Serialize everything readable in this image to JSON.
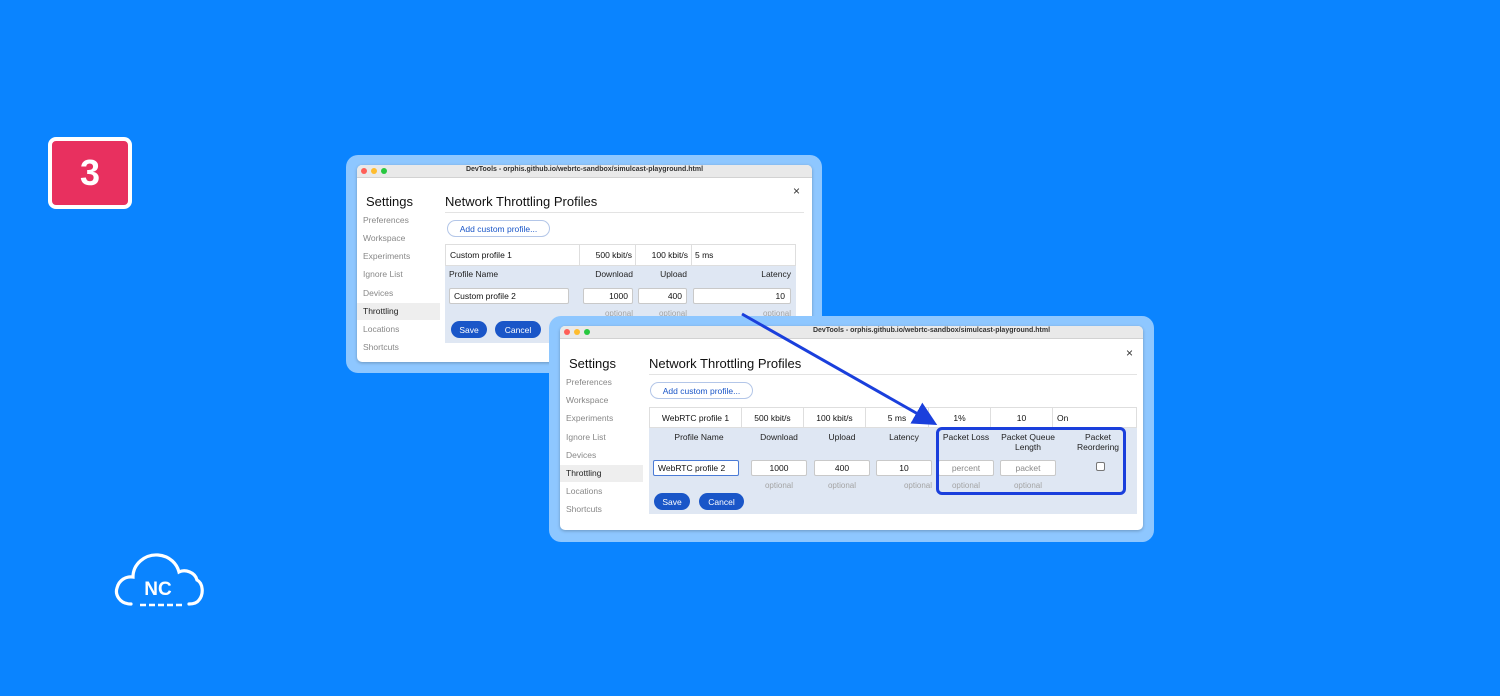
{
  "step": {
    "number": "3"
  },
  "logo": {
    "text": "NC"
  },
  "colors": {
    "background": "#0a84ff",
    "badge": "#e8305f",
    "accent": "#1a56c8",
    "highlight": "#1a3fdc",
    "panel": "#dfe7f3"
  },
  "window1": {
    "title": "DevTools - orphis.github.io/webrtc-sandbox/simulcast-playground.html",
    "close": "×",
    "sidebar": {
      "title": "Settings",
      "items": [
        {
          "label": "Preferences"
        },
        {
          "label": "Workspace"
        },
        {
          "label": "Experiments"
        },
        {
          "label": "Ignore List"
        },
        {
          "label": "Devices"
        },
        {
          "label": "Throttling"
        },
        {
          "label": "Locations"
        },
        {
          "label": "Shortcuts"
        }
      ]
    },
    "heading": "Network Throttling Profiles",
    "add_button": "Add custom profile...",
    "existing_profile": {
      "name": "Custom profile 1",
      "download": "500 kbit/s",
      "upload": "100 kbit/s",
      "latency": "5 ms"
    },
    "columns": {
      "name": "Profile Name",
      "download": "Download",
      "upload": "Upload",
      "latency": "Latency"
    },
    "form": {
      "name": "Custom profile 2",
      "download": "1000",
      "upload": "400",
      "latency": "10"
    },
    "optional": "optional",
    "save": "Save",
    "cancel": "Cancel"
  },
  "window2": {
    "title": "DevTools - orphis.github.io/webrtc-sandbox/simulcast-playground.html",
    "close": "×",
    "sidebar": {
      "title": "Settings",
      "items": [
        {
          "label": "Preferences"
        },
        {
          "label": "Workspace"
        },
        {
          "label": "Experiments"
        },
        {
          "label": "Ignore List"
        },
        {
          "label": "Devices"
        },
        {
          "label": "Throttling"
        },
        {
          "label": "Locations"
        },
        {
          "label": "Shortcuts"
        }
      ]
    },
    "heading": "Network Throttling Profiles",
    "add_button": "Add custom profile...",
    "existing_profile": {
      "name": "WebRTC profile 1",
      "download": "500 kbit/s",
      "upload": "100 kbit/s",
      "latency": "5 ms",
      "packet_loss": "1%",
      "queue_length": "10",
      "reordering": "On"
    },
    "columns": {
      "name": "Profile Name",
      "download": "Download",
      "upload": "Upload",
      "latency": "Latency",
      "packet_loss": "Packet Loss",
      "queue_line1": "Packet Queue",
      "queue_line2": "Length",
      "reorder_line1": "Packet",
      "reorder_line2": "Reordering"
    },
    "form": {
      "name": "WebRTC profile 2",
      "download": "1000",
      "upload": "400",
      "latency": "10",
      "packet_loss_placeholder": "percent",
      "queue_placeholder": "packet",
      "reordering_checked": false
    },
    "optional": "optional",
    "save": "Save",
    "cancel": "Cancel"
  }
}
